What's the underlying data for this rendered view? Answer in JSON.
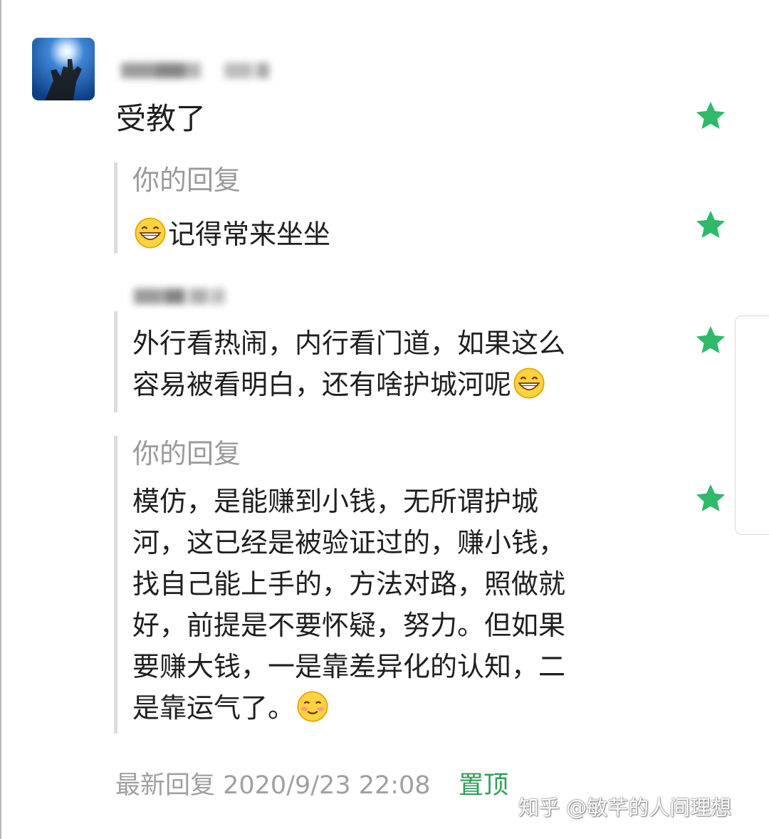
{
  "comment": {
    "text": "受教了"
  },
  "replies": [
    {
      "label": "你的回复",
      "text": "记得常来坐坐"
    },
    {
      "lines": [
        "外行看热闹，内行看门道，如果这么",
        "容易被看明白，还有啥护城河呢"
      ]
    },
    {
      "label": "你的回复",
      "lines": [
        "模仿，是能赚到小钱，无所谓护城",
        "河，这已经是被验证过的，赚小钱，",
        "找自己能上手的，方法对路，照做就",
        "好，前提是不要怀疑，努力。但如果",
        "要赚大钱，一是靠差异化的认知，二",
        "是靠运气了。"
      ]
    }
  ],
  "footer": {
    "latest_reply": "最新回复 2020/9/23 22:08",
    "pin_label": "置顶"
  },
  "watermark": "知乎 @敏芊的人间理想",
  "colors": {
    "accent_green": "#2e9e55",
    "star_green": "#2fb96b",
    "muted_gray": "#9a9a9a"
  },
  "icons": {
    "star": "star-icon",
    "grin_emoji": "grinning-emoji-icon",
    "smile_emoji": "blushing-smile-emoji-icon"
  }
}
